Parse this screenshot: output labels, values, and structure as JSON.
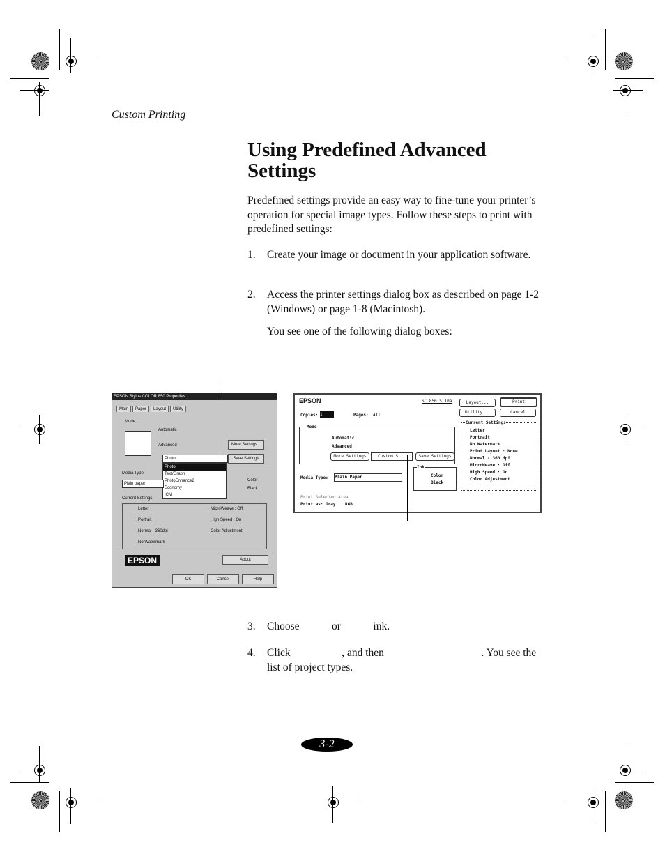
{
  "header": {
    "section": "Custom Printing"
  },
  "title": "Using Predefined Advanced Settings",
  "intro": "Predefined settings provide an easy way to fine-tune your printer’s operation for special image types. Follow these steps to print with predefined settings:",
  "steps": [
    {
      "num": "1.",
      "text": "Create your image or document in your application software."
    },
    {
      "num": "2.",
      "text": "Access the printer settings dialog box as described on page 1-2 (Windows) or page 1-8 (Macintosh)."
    },
    {
      "num": "3.",
      "text": "Choose            or            ink."
    },
    {
      "num": "4.",
      "text": "Click                   , and then                                    . You see the list of project types."
    }
  ],
  "note": "You see one of the following dialog boxes:",
  "page_number": "3-2",
  "windows_dialog": {
    "title": "EPSON Stylus COLOR 850 Properties",
    "tabs": [
      "Main",
      "Paper",
      "Layout",
      "Utility"
    ],
    "mode_label": "Mode",
    "mode_automatic": "Automatic",
    "mode_advanced": "Advanced",
    "dropdown_value": "Photo",
    "dropdown_options": [
      "Photo",
      "Text/Graph",
      "PhotoEnhance2",
      "Economy",
      "ICM"
    ],
    "more_settings": "More Settings...",
    "save_settings": "Save Settings",
    "media_type_label": "Media Type",
    "media_type_value": "Plain paper",
    "ink_color": "Color",
    "ink_black": "Black",
    "current_settings_label": "Current Settings",
    "current_settings_left": [
      "Letter",
      "Portrait",
      "Normal - 360dpi",
      "No Watermark"
    ],
    "current_settings_right": [
      "MicroWeave : Off",
      "High Speed : On",
      "Color Adjustment"
    ],
    "logo": "EPSON",
    "about": "About",
    "ok": "OK",
    "cancel": "Cancel",
    "help": "Help"
  },
  "mac_dialog": {
    "brand": "EPSON",
    "version": "SC 850 5.10a",
    "copies_label": "Copies:",
    "copies_value": "1",
    "pages_label": "Pages:",
    "pages_all": "All",
    "mode_label": "Mode",
    "mode_automatic": "Automatic",
    "mode_advanced": "Advanced",
    "more_settings": "More Settings",
    "custom_value": "Custom S...",
    "save_settings": "Save Settings",
    "media_type_label": "Media Type:",
    "media_type_value": "Plain Paper",
    "ink_label": "Ink",
    "ink_color": "Color",
    "ink_black": "Black",
    "print_selected_area": "Print Selected Area",
    "print_as_label": "Print as:",
    "print_as_gray": "Gray",
    "print_as_rgb": "RGB",
    "layout_button": "Layout...",
    "print_button": "Print",
    "utility_button": "Utility...",
    "cancel_button": "Cancel",
    "current_settings_label": "Current Settings",
    "current_settings": [
      "Letter",
      "Portrait",
      "No Watermark",
      "Print Layout : None",
      "Normal - 360 dpi",
      "MicroWeave : Off",
      "High Speed : On",
      "Color Adjustment"
    ]
  }
}
